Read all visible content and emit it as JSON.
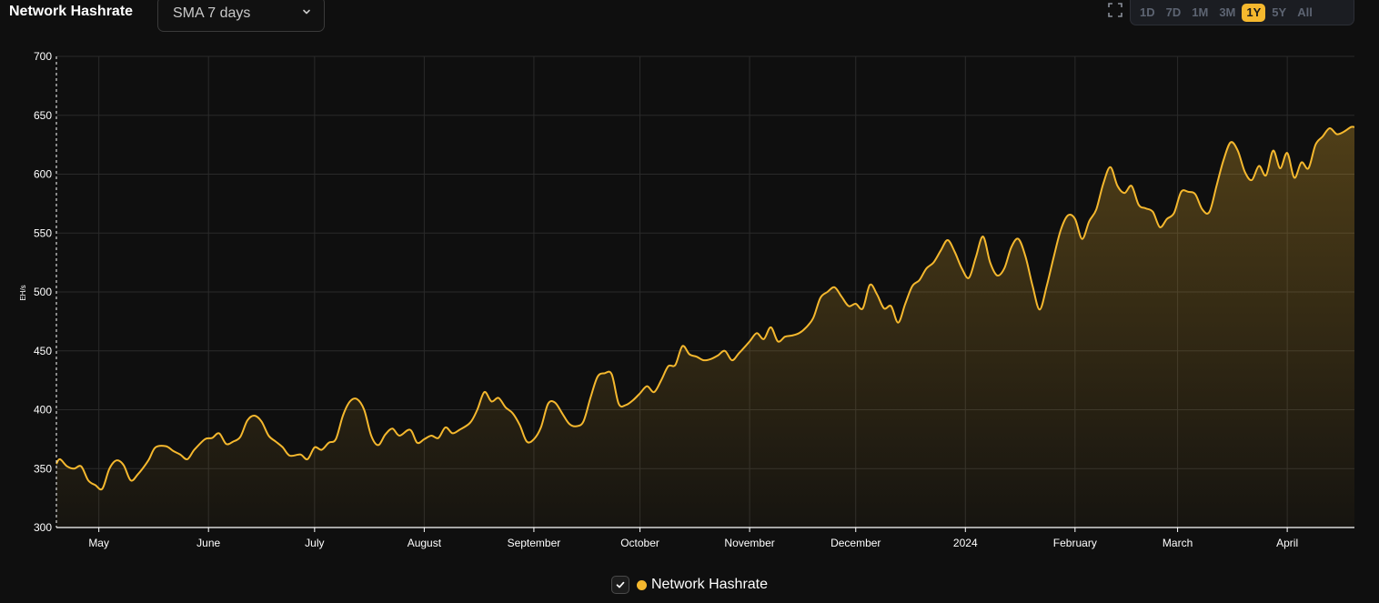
{
  "header": {
    "title": "Network Hashrate",
    "select_value": "SMA 7 days",
    "ranges": [
      "1D",
      "7D",
      "1M",
      "3M",
      "1Y",
      "5Y",
      "All"
    ],
    "active_range": "1Y"
  },
  "legend": {
    "label": "Network Hashrate"
  },
  "colors": {
    "line": "#f5b82e",
    "background": "#0f0f0f",
    "grid": "#2a2a2a",
    "axis": "#ffffff"
  },
  "chart_data": {
    "type": "area",
    "title": "Network Hashrate",
    "ylabel": "EH/s",
    "xlabel": "",
    "ylim": [
      300,
      700
    ],
    "yticks": [
      300,
      350,
      400,
      450,
      500,
      550,
      600,
      650,
      700
    ],
    "month_labels": [
      "May",
      "June",
      "July",
      "August",
      "September",
      "October",
      "November",
      "December",
      "2024",
      "February",
      "March",
      "April"
    ],
    "x_start": "2023-04-19",
    "x_end": "2024-04-20",
    "month_dates": [
      "2023-05-01",
      "2023-06-01",
      "2023-07-01",
      "2023-08-01",
      "2023-09-01",
      "2023-10-01",
      "2023-11-01",
      "2023-12-01",
      "2024-01-01",
      "2024-02-01",
      "2024-03-01",
      "2024-04-01"
    ],
    "grid": true,
    "legend": "bottom-center",
    "series": [
      {
        "name": "Network Hashrate",
        "points": [
          [
            "2023-04-19",
            354
          ],
          [
            "2023-04-20",
            358
          ],
          [
            "2023-04-22",
            352
          ],
          [
            "2023-04-24",
            350
          ],
          [
            "2023-04-26",
            352
          ],
          [
            "2023-04-28",
            340
          ],
          [
            "2023-04-30",
            336
          ],
          [
            "2023-05-02",
            333
          ],
          [
            "2023-05-04",
            350
          ],
          [
            "2023-05-06",
            357
          ],
          [
            "2023-05-08",
            353
          ],
          [
            "2023-05-10",
            340
          ],
          [
            "2023-05-12",
            345
          ],
          [
            "2023-05-15",
            357
          ],
          [
            "2023-05-17",
            368
          ],
          [
            "2023-05-20",
            369
          ],
          [
            "2023-05-22",
            365
          ],
          [
            "2023-05-24",
            362
          ],
          [
            "2023-05-26",
            358
          ],
          [
            "2023-05-28",
            366
          ],
          [
            "2023-05-31",
            375
          ],
          [
            "2023-06-02",
            376
          ],
          [
            "2023-06-04",
            380
          ],
          [
            "2023-06-06",
            371
          ],
          [
            "2023-06-08",
            373
          ],
          [
            "2023-06-10",
            377
          ],
          [
            "2023-06-12",
            391
          ],
          [
            "2023-06-14",
            395
          ],
          [
            "2023-06-16",
            390
          ],
          [
            "2023-06-18",
            378
          ],
          [
            "2023-06-20",
            373
          ],
          [
            "2023-06-22",
            368
          ],
          [
            "2023-06-24",
            361
          ],
          [
            "2023-06-27",
            362
          ],
          [
            "2023-06-29",
            358
          ],
          [
            "2023-07-01",
            368
          ],
          [
            "2023-07-03",
            366
          ],
          [
            "2023-07-05",
            372
          ],
          [
            "2023-07-07",
            375
          ],
          [
            "2023-07-09",
            395
          ],
          [
            "2023-07-11",
            407
          ],
          [
            "2023-07-13",
            409
          ],
          [
            "2023-07-15",
            400
          ],
          [
            "2023-07-17",
            378
          ],
          [
            "2023-07-19",
            370
          ],
          [
            "2023-07-21",
            379
          ],
          [
            "2023-07-23",
            384
          ],
          [
            "2023-07-25",
            378
          ],
          [
            "2023-07-28",
            383
          ],
          [
            "2023-07-30",
            372
          ],
          [
            "2023-08-01",
            375
          ],
          [
            "2023-08-03",
            378
          ],
          [
            "2023-08-05",
            376
          ],
          [
            "2023-08-07",
            385
          ],
          [
            "2023-08-09",
            380
          ],
          [
            "2023-08-11",
            383
          ],
          [
            "2023-08-14",
            389
          ],
          [
            "2023-08-16",
            400
          ],
          [
            "2023-08-18",
            415
          ],
          [
            "2023-08-20",
            407
          ],
          [
            "2023-08-22",
            410
          ],
          [
            "2023-08-24",
            402
          ],
          [
            "2023-08-26",
            397
          ],
          [
            "2023-08-28",
            387
          ],
          [
            "2023-08-30",
            373
          ],
          [
            "2023-09-01",
            375
          ],
          [
            "2023-09-03",
            385
          ],
          [
            "2023-09-05",
            405
          ],
          [
            "2023-09-07",
            406
          ],
          [
            "2023-09-09",
            397
          ],
          [
            "2023-09-11",
            388
          ],
          [
            "2023-09-13",
            386
          ],
          [
            "2023-09-15",
            390
          ],
          [
            "2023-09-17",
            410
          ],
          [
            "2023-09-19",
            428
          ],
          [
            "2023-09-21",
            431
          ],
          [
            "2023-09-23",
            430
          ],
          [
            "2023-09-25",
            405
          ],
          [
            "2023-09-27",
            404
          ],
          [
            "2023-09-29",
            408
          ],
          [
            "2023-10-01",
            414
          ],
          [
            "2023-10-03",
            420
          ],
          [
            "2023-10-05",
            415
          ],
          [
            "2023-10-07",
            425
          ],
          [
            "2023-10-09",
            437
          ],
          [
            "2023-10-11",
            438
          ],
          [
            "2023-10-13",
            454
          ],
          [
            "2023-10-15",
            447
          ],
          [
            "2023-10-17",
            445
          ],
          [
            "2023-10-19",
            442
          ],
          [
            "2023-10-21",
            443
          ],
          [
            "2023-10-23",
            446
          ],
          [
            "2023-10-25",
            450
          ],
          [
            "2023-10-27",
            442
          ],
          [
            "2023-10-29",
            448
          ],
          [
            "2023-11-01",
            458
          ],
          [
            "2023-11-03",
            465
          ],
          [
            "2023-11-05",
            460
          ],
          [
            "2023-11-07",
            470
          ],
          [
            "2023-11-09",
            458
          ],
          [
            "2023-11-11",
            462
          ],
          [
            "2023-11-13",
            463
          ],
          [
            "2023-11-15",
            465
          ],
          [
            "2023-11-17",
            470
          ],
          [
            "2023-11-19",
            478
          ],
          [
            "2023-11-21",
            495
          ],
          [
            "2023-11-23",
            500
          ],
          [
            "2023-11-25",
            504
          ],
          [
            "2023-11-27",
            496
          ],
          [
            "2023-11-29",
            488
          ],
          [
            "2023-12-01",
            490
          ],
          [
            "2023-12-03",
            486
          ],
          [
            "2023-12-05",
            506
          ],
          [
            "2023-12-07",
            498
          ],
          [
            "2023-12-09",
            486
          ],
          [
            "2023-12-11",
            488
          ],
          [
            "2023-12-13",
            474
          ],
          [
            "2023-12-15",
            490
          ],
          [
            "2023-12-17",
            505
          ],
          [
            "2023-12-19",
            510
          ],
          [
            "2023-12-21",
            520
          ],
          [
            "2023-12-23",
            525
          ],
          [
            "2023-12-25",
            535
          ],
          [
            "2023-12-27",
            544
          ],
          [
            "2023-12-29",
            534
          ],
          [
            "2023-12-31",
            520
          ],
          [
            "2024-01-02",
            512
          ],
          [
            "2024-01-04",
            530
          ],
          [
            "2024-01-06",
            547
          ],
          [
            "2024-01-08",
            525
          ],
          [
            "2024-01-10",
            514
          ],
          [
            "2024-01-12",
            520
          ],
          [
            "2024-01-14",
            538
          ],
          [
            "2024-01-16",
            545
          ],
          [
            "2024-01-18",
            530
          ],
          [
            "2024-01-20",
            505
          ],
          [
            "2024-01-22",
            485
          ],
          [
            "2024-01-24",
            505
          ],
          [
            "2024-01-26",
            530
          ],
          [
            "2024-01-28",
            553
          ],
          [
            "2024-01-30",
            565
          ],
          [
            "2024-02-01",
            562
          ],
          [
            "2024-02-03",
            545
          ],
          [
            "2024-02-05",
            560
          ],
          [
            "2024-02-07",
            570
          ],
          [
            "2024-02-09",
            592
          ],
          [
            "2024-02-11",
            606
          ],
          [
            "2024-02-13",
            590
          ],
          [
            "2024-02-15",
            584
          ],
          [
            "2024-02-17",
            590
          ],
          [
            "2024-02-19",
            574
          ],
          [
            "2024-02-21",
            571
          ],
          [
            "2024-02-23",
            568
          ],
          [
            "2024-02-25",
            555
          ],
          [
            "2024-02-27",
            562
          ],
          [
            "2024-02-29",
            567
          ],
          [
            "2024-03-02",
            585
          ],
          [
            "2024-03-04",
            585
          ],
          [
            "2024-03-06",
            583
          ],
          [
            "2024-03-08",
            570
          ],
          [
            "2024-03-10",
            568
          ],
          [
            "2024-03-12",
            590
          ],
          [
            "2024-03-14",
            612
          ],
          [
            "2024-03-16",
            627
          ],
          [
            "2024-03-18",
            620
          ],
          [
            "2024-03-20",
            602
          ],
          [
            "2024-03-22",
            595
          ],
          [
            "2024-03-24",
            607
          ],
          [
            "2024-03-26",
            599
          ],
          [
            "2024-03-28",
            620
          ],
          [
            "2024-03-30",
            605
          ],
          [
            "2024-04-01",
            618
          ],
          [
            "2024-04-03",
            597
          ],
          [
            "2024-04-05",
            610
          ],
          [
            "2024-04-07",
            605
          ],
          [
            "2024-04-09",
            625
          ],
          [
            "2024-04-11",
            632
          ],
          [
            "2024-04-13",
            639
          ],
          [
            "2024-04-15",
            634
          ],
          [
            "2024-04-17",
            636
          ],
          [
            "2024-04-19",
            640
          ],
          [
            "2024-04-20",
            640
          ]
        ]
      }
    ]
  }
}
